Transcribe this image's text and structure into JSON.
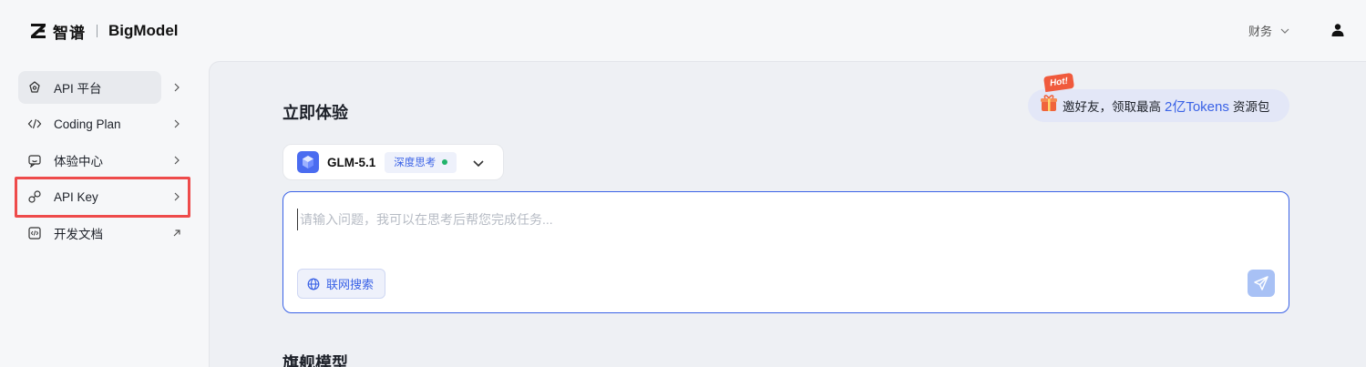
{
  "header": {
    "logo_cn": "智谱",
    "logo_en": "BigModel",
    "finance_label": "财务"
  },
  "sidebar": {
    "items": [
      {
        "label": "API 平台",
        "icon": "api-platform-icon",
        "arrow": "chevron-right",
        "active": true
      },
      {
        "label": "Coding Plan",
        "icon": "code-icon",
        "arrow": "chevron-right",
        "active": false
      },
      {
        "label": "体验中心",
        "icon": "chat-robot-icon",
        "arrow": "chevron-right",
        "active": false
      },
      {
        "label": "API Key",
        "icon": "key-link-icon",
        "arrow": "chevron-right",
        "active": false,
        "highlighted": true
      },
      {
        "label": "开发文档",
        "icon": "doc-code-icon",
        "arrow": "external-arrow",
        "active": false
      }
    ]
  },
  "main": {
    "section_title": "立即体验",
    "section_title_2": "旗舰模型",
    "promo": {
      "badge": "Hot!",
      "text_prefix": "邀好友，领取最高",
      "text_accent": "2亿Tokens",
      "text_suffix": "资源包"
    },
    "model_select": {
      "model_name": "GLM-5.1",
      "mode_label": "深度思考"
    },
    "chat": {
      "placeholder": "请输入问题，我可以在思考后帮您完成任务...",
      "value": "",
      "web_search_label": "联网搜索"
    }
  },
  "colors": {
    "accent": "#3a62e6",
    "highlight_border": "#ee4b4b",
    "hot_badge": "#f05a3c",
    "status_green": "#21b36b"
  }
}
